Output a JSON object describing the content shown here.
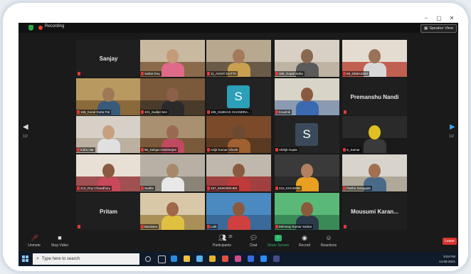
{
  "window": {
    "recording_label": "Recording",
    "speaker_view_label": "Speaker View",
    "controls": [
      "–",
      "▢",
      "✕"
    ]
  },
  "tiles": [
    {
      "id": "r1c1",
      "type": "name",
      "name": "Sanjay"
    },
    {
      "id": "r1c2",
      "type": "video",
      "caption": "Saibal Dey",
      "wall": "#c9b9a0",
      "floor": "#8a6a4a",
      "head": "#c49a78",
      "body": "#e06a8a"
    },
    {
      "id": "r1c3",
      "type": "video",
      "caption": "11_AVIJIT DUTTA",
      "wall": "#b8a890",
      "floor": "#6a5a48",
      "head": "#a57a5a",
      "body": "#c8a050"
    },
    {
      "id": "r1c4",
      "type": "video",
      "caption": "155_Gopal Saha",
      "wall": "#d8d0c4",
      "floor": "#bfb4a4",
      "head": "#8a6850",
      "body": "#5a5a5a"
    },
    {
      "id": "r1c5",
      "type": "video",
      "caption": "68_DEBASISH",
      "wall": "#e4dcd0",
      "floor": "#c06050",
      "head": "#9a7258",
      "body": "#d8d8d8"
    },
    {
      "id": "r2c1",
      "type": "video",
      "caption": "155_Kazal Dutta Pal",
      "wall": "#b89a60",
      "floor": "#8a6a3a",
      "head": "#a07858",
      "body": "#3a5a7a"
    },
    {
      "id": "r2c2",
      "type": "video",
      "caption": "101_Sudipt Sen",
      "wall": "#7a5a3a",
      "floor": "#4a3a2a",
      "head": "#8a6048",
      "body": "#2a2a2a"
    },
    {
      "id": "r2c3",
      "type": "avatar",
      "letter": "S",
      "color": "#2ca0b8",
      "caption": "105_SUBHAS CHANDRA..."
    },
    {
      "id": "r2c4",
      "type": "video",
      "caption": "Koushik",
      "wall": "#d8d4c8",
      "floor": "#8a9ab0",
      "head": "#8a5a40",
      "body": "#3a6ab0"
    },
    {
      "id": "r2c5",
      "type": "name",
      "name": "Premanshu Nandi"
    },
    {
      "id": "r3c1",
      "type": "video",
      "caption": "Indra Har",
      "wall": "#d6d0c6",
      "floor": "#bcb0a0",
      "head": "#c8a080",
      "body": "#e0e0e0"
    },
    {
      "id": "r3c2",
      "type": "video",
      "caption": "96_Debjani Mukherjee",
      "wall": "#a89070",
      "floor": "#7a5a3a",
      "head": "#9a6a50",
      "body": "#c04a60"
    },
    {
      "id": "r3c3",
      "type": "video",
      "caption": "Avijit Kumar Ghosh",
      "wall": "#7a4a2a",
      "floor": "#5a3a20",
      "head": "#6a4a30",
      "body": "#a06030"
    },
    {
      "id": "r3c4",
      "type": "avatar",
      "letter": "S",
      "color": "#3a4a5a",
      "caption": "Abhijit Gupta"
    },
    {
      "id": "r3c5",
      "type": "video",
      "caption": "S_Samar",
      "wall": "#2a2a2a",
      "floor": "#1a1a1a",
      "head": "#e0c020",
      "body": "#3a3a3a"
    },
    {
      "id": "r4c1",
      "type": "video",
      "caption": "213_Roy Chowdhury",
      "wall": "#e8e0d4",
      "floor": "#a05050",
      "head": "#8a5a40",
      "body": "#c84a5a"
    },
    {
      "id": "r4c2",
      "type": "video",
      "caption": "Sudhir",
      "wall": "#b8b0a4",
      "floor": "#8a8478",
      "head": "#a88868",
      "body": "#e8e8e8"
    },
    {
      "id": "r4c3",
      "type": "video",
      "caption": "157_MUKHERJEE",
      "wall": "#c0b8ac",
      "floor": "#a04040",
      "head": "#8a5a40",
      "body": "#c03a3a"
    },
    {
      "id": "r4c4",
      "type": "video",
      "caption": "210_KOUSHIK",
      "wall": "#3a3a3a",
      "floor": "#2a2a2a",
      "head": "#b08060",
      "body": "#e8a020"
    },
    {
      "id": "r4c5",
      "type": "video",
      "caption": "Partha Sengupta",
      "wall": "#d8d4cc",
      "floor": "#b0a898",
      "head": "#a07050",
      "body": "#4a6a8a"
    },
    {
      "id": "r5c1",
      "type": "name",
      "name": "Pritam"
    },
    {
      "id": "r5c2",
      "type": "video",
      "caption": "Bandana",
      "active": true,
      "wall": "#d8c8a8",
      "floor": "#a89058",
      "head": "#a06848",
      "body": "#e0c040"
    },
    {
      "id": "r5c3",
      "type": "video",
      "caption": "Lalit",
      "wall": "#4a8ac0",
      "floor": "#3a6a9a",
      "head": "#8a5a40",
      "body": "#d04040"
    },
    {
      "id": "r5c4",
      "type": "video",
      "caption": "Mrinmoy Kumar Sarkar",
      "wall": "#5ab878",
      "floor": "#3a8a58",
      "head": "#8a5a3a",
      "body": "#2a3a4a"
    },
    {
      "id": "r5c5",
      "type": "name",
      "name": "Mousumi Karan..."
    }
  ],
  "nav": {
    "prev_page": "1/2",
    "next_page": "1/2"
  },
  "toolbar": {
    "unmute": "Unmute",
    "stop_video": "Stop Video",
    "participants": "Participants",
    "participants_count": "35",
    "chat": "Chat",
    "share_screen": "Share Screen",
    "record": "Record",
    "reactions": "Reactions",
    "leave": "Leave"
  },
  "taskbar": {
    "search_placeholder": "Type here to search",
    "time": "9:04 PM",
    "date": "14-05-2021"
  }
}
